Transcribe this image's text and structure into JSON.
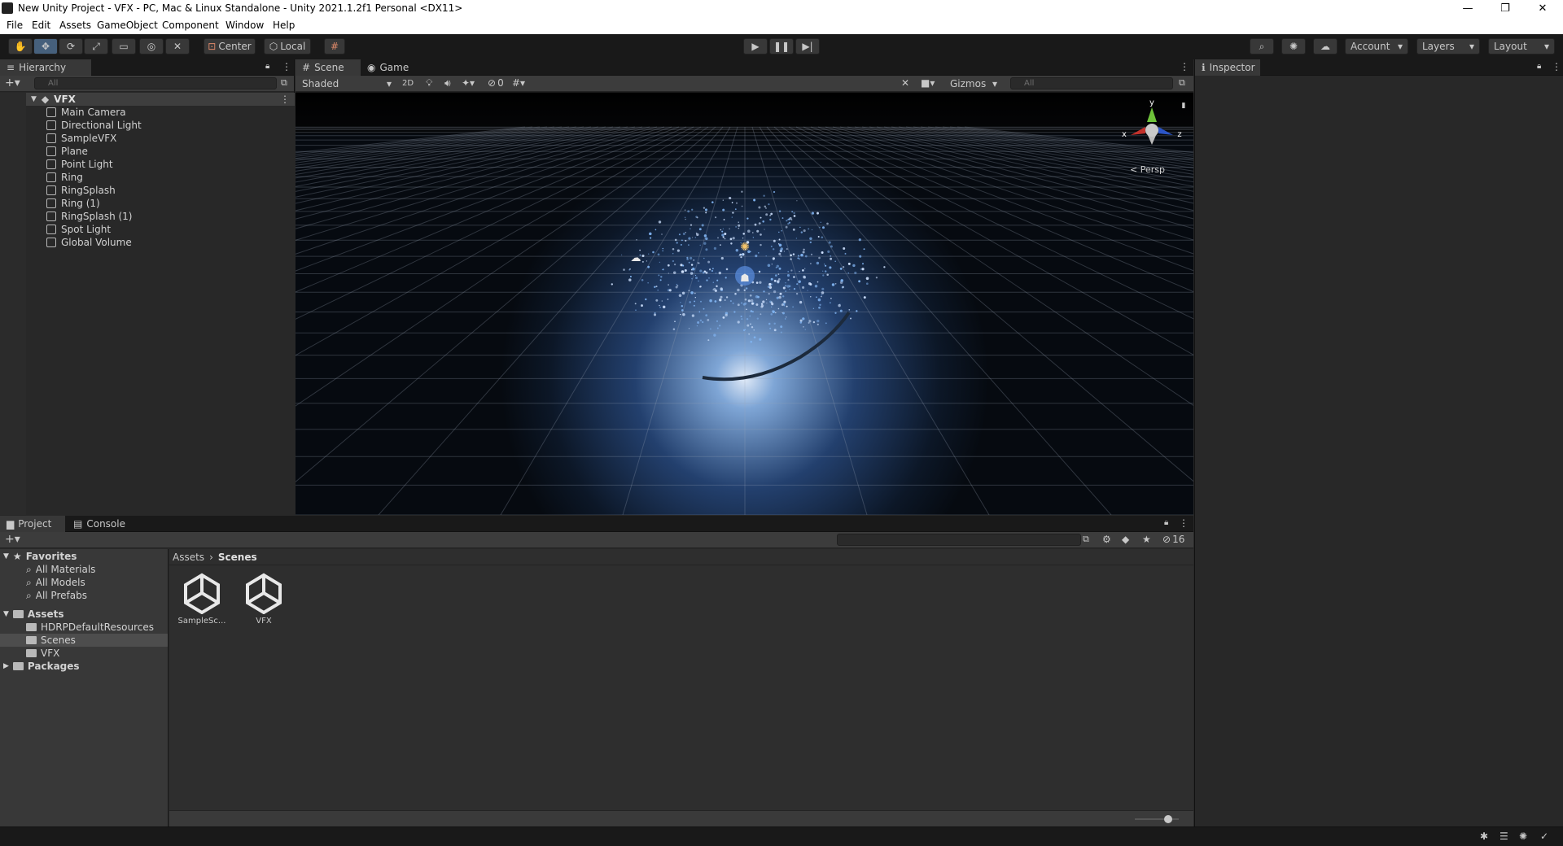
{
  "window": {
    "title": "New Unity Project - VFX - PC, Mac & Linux Standalone - Unity 2021.1.2f1 Personal <DX11>",
    "minimize": "—",
    "restore": "❐",
    "close": "✕"
  },
  "menu": [
    "File",
    "Edit",
    "Assets",
    "GameObject",
    "Component",
    "Window",
    "Help"
  ],
  "toolbar": {
    "pivot_label": "Center",
    "space_label": "Local",
    "account_label": "Account",
    "layers_label": "Layers",
    "layout_label": "Layout"
  },
  "hierarchy": {
    "tab": "Hierarchy",
    "search_placeholder": "All",
    "scene_name": "VFX",
    "items": [
      "Main Camera",
      "Directional Light",
      "SampleVFX",
      "Plane",
      "Point Light",
      "Ring",
      "RingSplash",
      "Ring (1)",
      "RingSplash (1)",
      "Spot Light",
      "Global Volume"
    ]
  },
  "scene": {
    "tab_scene": "Scene",
    "tab_game": "Game",
    "shading_mode": "Shaded",
    "toggle_2d": "2D",
    "hidden_count": "0",
    "gizmos_label": "Gizmos",
    "search_placeholder": "All",
    "axis_y": "y",
    "axis_x": "x",
    "axis_z": "z",
    "persp_label": "< Persp"
  },
  "inspector": {
    "tab": "Inspector"
  },
  "project": {
    "tab_project": "Project",
    "tab_console": "Console",
    "hidden_packages_count": "16",
    "favorites_label": "Favorites",
    "favorites": [
      "All Materials",
      "All Models",
      "All Prefabs"
    ],
    "assets_label": "Assets",
    "asset_folders": [
      "HDRPDefaultResources",
      "Scenes",
      "VFX"
    ],
    "packages_label": "Packages",
    "breadcrumb": [
      "Assets",
      "Scenes"
    ],
    "files": [
      "SampleSc...",
      "VFX"
    ],
    "zoom_slider_level": 0.75
  },
  "colors": {
    "accent_selection": "#46607c",
    "scene_bg": "#0b0f17",
    "panel_bg": "#282828",
    "toolbar_bg": "#191919"
  }
}
